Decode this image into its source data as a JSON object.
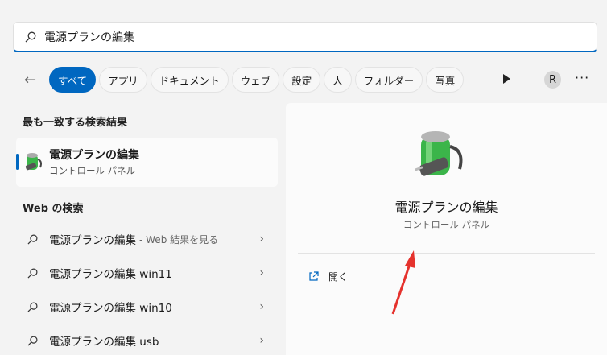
{
  "search": {
    "value": "電源プランの編集"
  },
  "filters": {
    "chips": [
      "すべて",
      "アプリ",
      "ドキュメント",
      "ウェブ",
      "設定",
      "人",
      "フォルダー",
      "写真"
    ],
    "avatar": "R",
    "more": "···"
  },
  "best_match": {
    "heading": "最も一致する検索結果",
    "title": "電源プランの編集",
    "subtitle": "コントロール パネル"
  },
  "web": {
    "heading": "Web の検索",
    "items": [
      {
        "query": "電源プランの編集",
        "suffix": " - Web 結果を見る"
      },
      {
        "query": "電源プランの編集 win11",
        "suffix": ""
      },
      {
        "query": "電源プランの編集 win10",
        "suffix": ""
      },
      {
        "query": "電源プランの編集 usb",
        "suffix": ""
      }
    ]
  },
  "preview": {
    "title": "電源プランの編集",
    "subtitle": "コントロール パネル",
    "action": "開く"
  },
  "colors": {
    "accent": "#0067c0",
    "annotation": "#e5322d"
  }
}
